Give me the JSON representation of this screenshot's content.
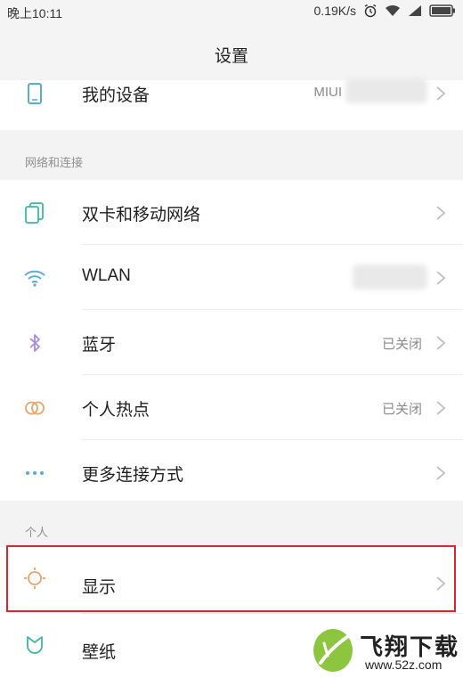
{
  "status_bar": {
    "time": "晚上10:11",
    "net_speed": "0.19K/s",
    "icons": [
      "alarm-icon",
      "wifi-icon",
      "signal-icon",
      "battery-icon"
    ]
  },
  "header": {
    "title": "设置"
  },
  "device_row": {
    "label": "我的设备",
    "value": "MIUI",
    "icon": "phone-icon"
  },
  "sections": {
    "network": {
      "title": "网络和连接",
      "items": [
        {
          "label": "双卡和移动网络",
          "value": "",
          "icon": "sim-card-icon"
        },
        {
          "label": "WLAN",
          "value": "",
          "icon": "wifi-icon"
        },
        {
          "label": "蓝牙",
          "value": "已关闭",
          "icon": "bluetooth-icon"
        },
        {
          "label": "个人热点",
          "value": "已关闭",
          "icon": "hotspot-icon"
        },
        {
          "label": "更多连接方式",
          "value": "",
          "icon": "more-dots-icon"
        }
      ]
    },
    "personal": {
      "title": "个人",
      "items": [
        {
          "label": "显示",
          "value": "",
          "icon": "sun-display-icon"
        },
        {
          "label": "壁纸",
          "value": "",
          "icon": "wallpaper-icon"
        }
      ]
    }
  },
  "colors": {
    "highlight": "#e0232e",
    "icon_blue": "#5aaed6",
    "icon_teal": "#3fb8a2",
    "icon_purple": "#a98be0",
    "icon_orange": "#e8a36a",
    "watermark_green": "#8cc63f"
  },
  "watermark": {
    "name": "飞翔下载",
    "url": "www.52z.com"
  }
}
